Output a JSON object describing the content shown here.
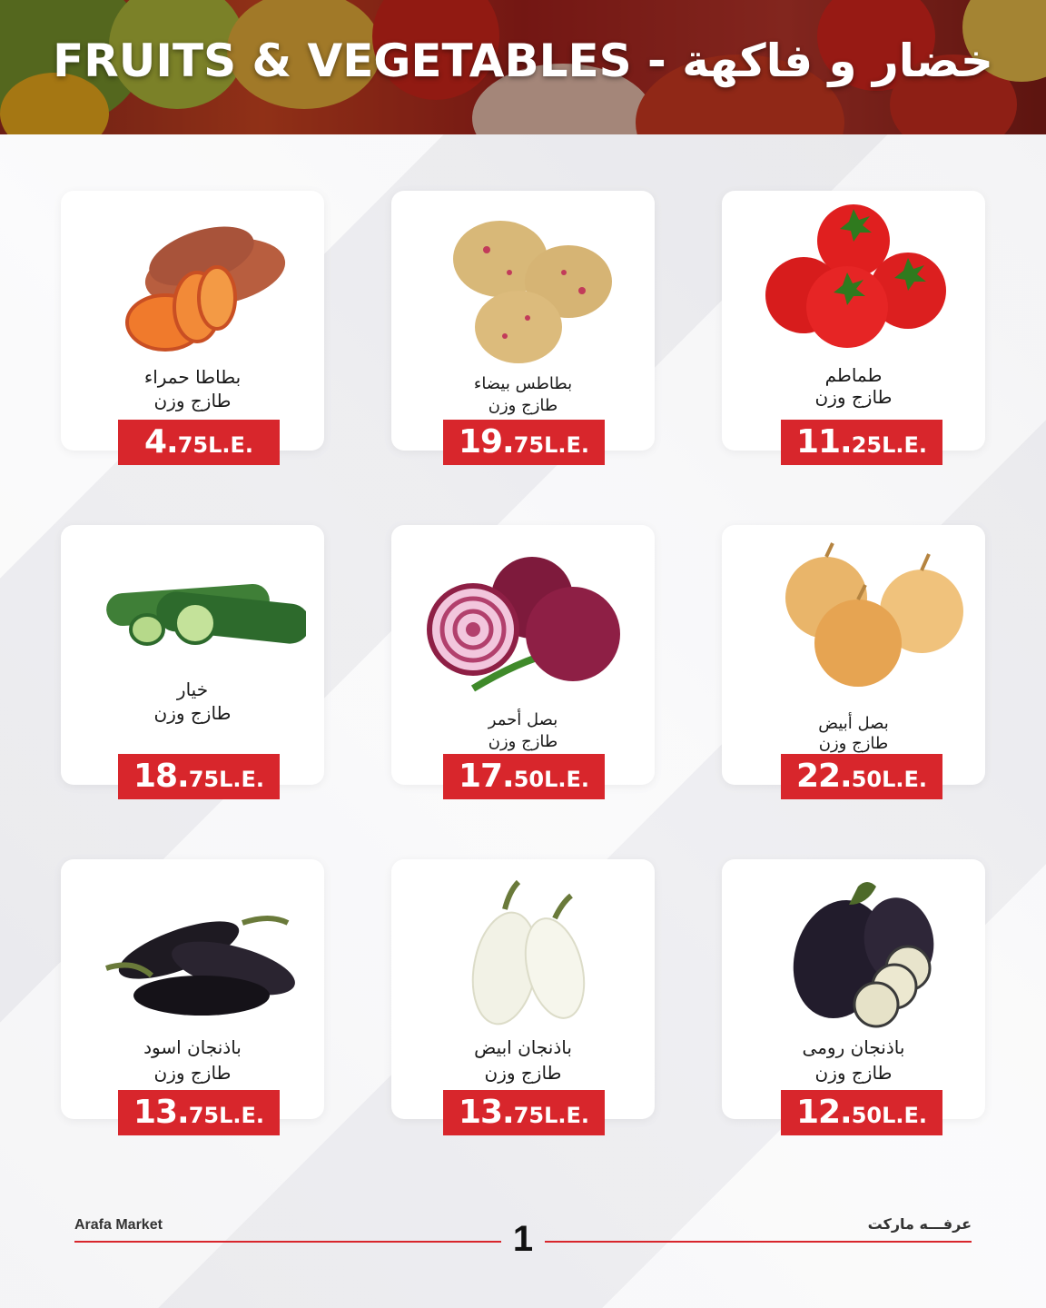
{
  "header": {
    "title": "FRUITS & VEGETABLES - خضار و فاكهة"
  },
  "products": [
    {
      "name": "بطاطا حمراء",
      "detail": "طازج وزن",
      "price_int": "4.",
      "price_dec": "75",
      "currency": "L.E.",
      "icon": "sweet-potato-icon"
    },
    {
      "name": "بطاطس بيضاء",
      "detail": "طازج وزن",
      "price_int": "19.",
      "price_dec": "75",
      "currency": "L.E.",
      "icon": "potato-icon"
    },
    {
      "name": "طماطم",
      "detail": "طازج وزن",
      "price_int": "11.",
      "price_dec": "25",
      "currency": "L.E.",
      "icon": "tomato-icon"
    },
    {
      "name": "خيار",
      "detail": "طازج وزن",
      "price_int": "18.",
      "price_dec": "75",
      "currency": "L.E.",
      "icon": "cucumber-icon"
    },
    {
      "name": "بصل أحمر",
      "detail": "طازج وزن",
      "price_int": "17.",
      "price_dec": "50",
      "currency": "L.E.",
      "icon": "red-onion-icon"
    },
    {
      "name": "بصل أبيض",
      "detail": "طازج وزن",
      "price_int": "22.",
      "price_dec": "50",
      "currency": "L.E.",
      "icon": "white-onion-icon"
    },
    {
      "name": "باذنجان اسود",
      "detail": "طازج وزن",
      "price_int": "13.",
      "price_dec": "75",
      "currency": "L.E.",
      "icon": "black-eggplant-icon"
    },
    {
      "name": "باذنجان ابيض",
      "detail": "طازج وزن",
      "price_int": "13.",
      "price_dec": "75",
      "currency": "L.E.",
      "icon": "white-eggplant-icon"
    },
    {
      "name": "باذنجان رومى",
      "detail": "طازج وزن",
      "price_int": "12.",
      "price_dec": "50",
      "currency": "L.E.",
      "icon": "roman-eggplant-icon"
    }
  ],
  "footer": {
    "left_text": "Arafa Market",
    "right_text": "عرفـــه ماركت",
    "page_number": "1"
  },
  "colors": {
    "accent": "#d8262c",
    "background": "#f1f1f3",
    "card": "#ffffff"
  }
}
